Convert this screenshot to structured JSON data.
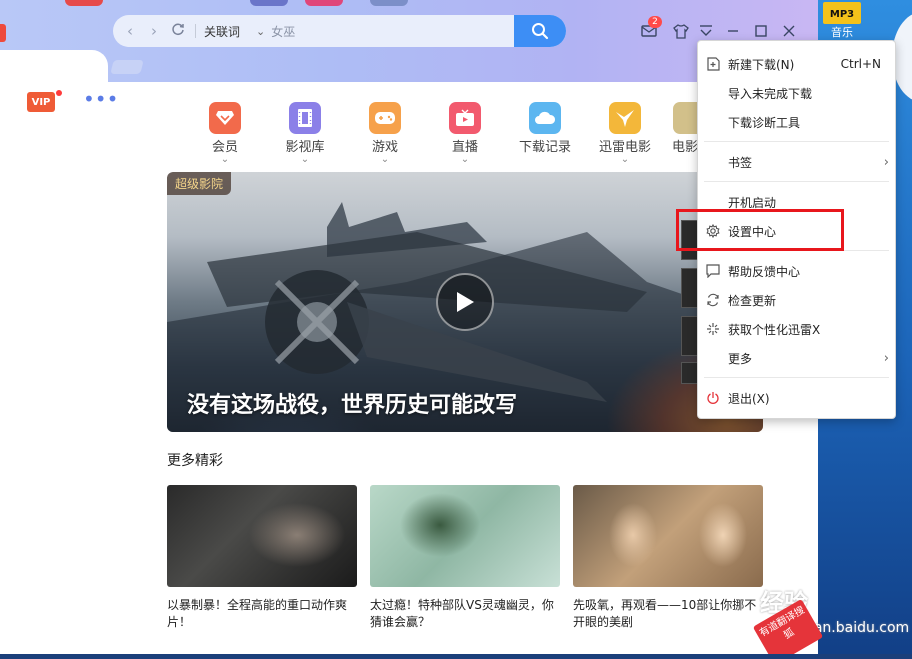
{
  "desktop": {
    "icon_badge": "MP3",
    "icon_label": "音乐"
  },
  "toolbar": {
    "search_category": "关联词",
    "search_placeholder": "女巫",
    "notification_count": "2"
  },
  "vip_label": "VIP",
  "categories": [
    {
      "label": "会员",
      "color": "#f26a4b"
    },
    {
      "label": "影视库",
      "color": "#8b80e8"
    },
    {
      "label": "游戏",
      "color": "#f6a14b"
    },
    {
      "label": "直播",
      "color": "#f25a6e"
    },
    {
      "label": "下载记录",
      "color": "#5cb6f0"
    },
    {
      "label": "迅雷电影",
      "color": "#f3b73a"
    },
    {
      "label": "电影",
      "color": "#d2c08a"
    }
  ],
  "hero": {
    "tag": "超级影院",
    "title": "没有这场战役，世界历史可能改写"
  },
  "section_title": "更多精彩",
  "cards": [
    {
      "caption": "以暴制暴！全程高能的重口动作爽片！"
    },
    {
      "caption": "太过瘾！特种部队VS灵魂幽灵，你猜谁会赢？"
    },
    {
      "caption": "先吸氧，再观看——10部让你挪不开眼的美剧"
    }
  ],
  "menu": {
    "items": [
      {
        "label": "新建下载(N)",
        "shortcut": "Ctrl+N",
        "icon": "new-download-icon"
      },
      {
        "label": "导入未完成下载"
      },
      {
        "label": "下载诊断工具"
      },
      {
        "label": "书签",
        "submenu": true
      },
      {
        "label": "开机启动"
      },
      {
        "label": "设置中心",
        "icon": "gear-icon"
      },
      {
        "label": "帮助反馈中心",
        "icon": "feedback-icon"
      },
      {
        "label": "检查更新",
        "icon": "refresh-icon"
      },
      {
        "label": "获取个性化迅雷X",
        "icon": "sparkle-icon"
      },
      {
        "label": "更多",
        "submenu": true
      },
      {
        "label": "退出(X)",
        "icon": "power-icon"
      }
    ]
  },
  "watermark": {
    "text": "经验",
    "url": "jingyan.baidu.com",
    "stamp": "有道翻译搜狐"
  }
}
